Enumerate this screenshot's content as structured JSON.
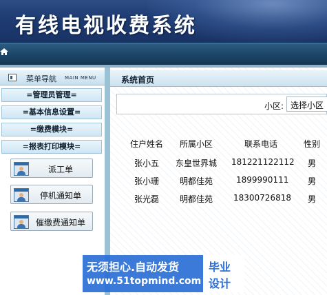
{
  "app": {
    "title": "有线电视收费系统"
  },
  "sidebar": {
    "header_label": "菜单导航",
    "header_sub": "MAIN MENU",
    "menus": [
      {
        "label": "=管理员管理="
      },
      {
        "label": "=基本信息设置="
      },
      {
        "label": "=缴费模块="
      },
      {
        "label": "=报表打印模块="
      }
    ],
    "sub_items": [
      {
        "label": "派工单",
        "icon": "user-icon"
      },
      {
        "label": "停机通知单",
        "icon": "user-icon"
      },
      {
        "label": "催缴费通知单",
        "icon": "user-icon"
      }
    ]
  },
  "main": {
    "title": "系统首页",
    "filter": {
      "label": "小区:",
      "select_value": "选择小区"
    },
    "table": {
      "columns": [
        "住户姓名",
        "所属小区",
        "联系电话",
        "性别"
      ],
      "rows": [
        [
          "张小五",
          "东皇世界城",
          "181221122112",
          "男"
        ],
        [
          "张小珊",
          "明都佳苑",
          "1899990111",
          "男"
        ],
        [
          "张光磊",
          "明都佳苑",
          "18300726818",
          "男"
        ]
      ]
    }
  },
  "watermark": {
    "line1": "无须担心.自动发货",
    "line2": "www.51topmind.com",
    "right1": "毕业",
    "right2": "设计"
  },
  "colors": {
    "banner": "#1f3c73",
    "nav": "#1c4467",
    "accent": "#2a6fd6",
    "menu_border": "#9ec3d8"
  }
}
